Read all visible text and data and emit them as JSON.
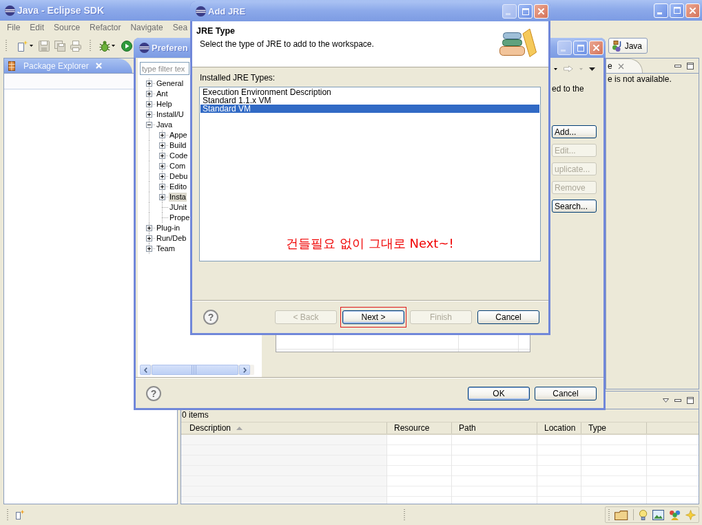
{
  "eclipse_window": {
    "title": "Java - Eclipse SDK",
    "can_minimize": true,
    "menu": [
      "File",
      "Edit",
      "Source",
      "Refactor",
      "Navigate",
      "Sea"
    ],
    "perspective": {
      "label": "Java",
      "selected": true
    }
  },
  "package_explorer": {
    "tab": "Package Explorer"
  },
  "outline_view": {
    "tab": "e",
    "message": "e is not available."
  },
  "problems_view": {
    "summary": "0 items",
    "columns": [
      {
        "label": "Description",
        "sorted": true
      },
      {
        "label": "Resource",
        "sorted": false
      },
      {
        "label": "Path",
        "sorted": false
      },
      {
        "label": "Location",
        "sorted": false
      },
      {
        "label": "Type",
        "sorted": false
      }
    ]
  },
  "preferences_dialog": {
    "title": "Preferen",
    "can_minimize": false,
    "filter": {
      "placeholder": "type filter tex"
    },
    "tree": [
      {
        "label": "General",
        "expanded": false,
        "selected": false
      },
      {
        "label": "Ant",
        "expanded": false,
        "selected": false
      },
      {
        "label": "Help",
        "expanded": false,
        "selected": false
      },
      {
        "label": "Install/U",
        "expanded": false,
        "selected": false
      },
      {
        "label": "Java",
        "expanded": true,
        "selected": false,
        "children": [
          {
            "label": "Appe",
            "expanded": false,
            "selected": false
          },
          {
            "label": "Build",
            "expanded": false,
            "selected": false
          },
          {
            "label": "Code",
            "expanded": false,
            "selected": false
          },
          {
            "label": "Com",
            "expanded": false,
            "selected": false
          },
          {
            "label": "Debu",
            "expanded": false,
            "selected": false
          },
          {
            "label": "Edito",
            "expanded": false,
            "selected": false
          },
          {
            "label": "Insta",
            "expanded": false,
            "selected": true
          },
          {
            "label": "JUnit",
            "selected": false
          },
          {
            "label": "Prope",
            "selected": false
          }
        ]
      },
      {
        "label": "Plug-in",
        "expanded": false,
        "selected": false
      },
      {
        "label": "Run/Deb",
        "expanded": false,
        "selected": false
      },
      {
        "label": "Team",
        "expanded": false,
        "selected": false
      }
    ],
    "page_text": "ed to the",
    "side_buttons": [
      {
        "label": "Add...",
        "disabled": false
      },
      {
        "label": "Edit...",
        "disabled": true
      },
      {
        "label": "uplicate...",
        "disabled": true
      },
      {
        "label": "Remove",
        "disabled": true
      },
      {
        "label": "Search...",
        "disabled": false
      }
    ],
    "help": "?",
    "buttons": [
      {
        "label": "OK",
        "default": true
      },
      {
        "label": "Cancel",
        "default": false
      }
    ]
  },
  "add_jre_dialog": {
    "title": "Add JRE",
    "can_minimize": false,
    "heading": "JRE Type",
    "description": "Select the type of JRE to add to the workspace.",
    "list_label": "Installed JRE Types:",
    "jre_types": [
      {
        "label": "Execution Environment Description",
        "selected": false
      },
      {
        "label": "Standard 1.1.x VM",
        "selected": false
      },
      {
        "label": "Standard VM",
        "selected": true
      }
    ],
    "annotation": "건들필요 없이 그대로 Next~!",
    "help": "?",
    "buttons": [
      {
        "label": "< Back",
        "disabled": true,
        "default": false,
        "highlighted": false
      },
      {
        "label": "Next >",
        "disabled": false,
        "default": true,
        "highlighted": true
      },
      {
        "label": "Finish",
        "disabled": true,
        "default": false,
        "highlighted": false
      },
      {
        "label": "Cancel",
        "disabled": false,
        "default": false,
        "highlighted": false
      }
    ]
  }
}
